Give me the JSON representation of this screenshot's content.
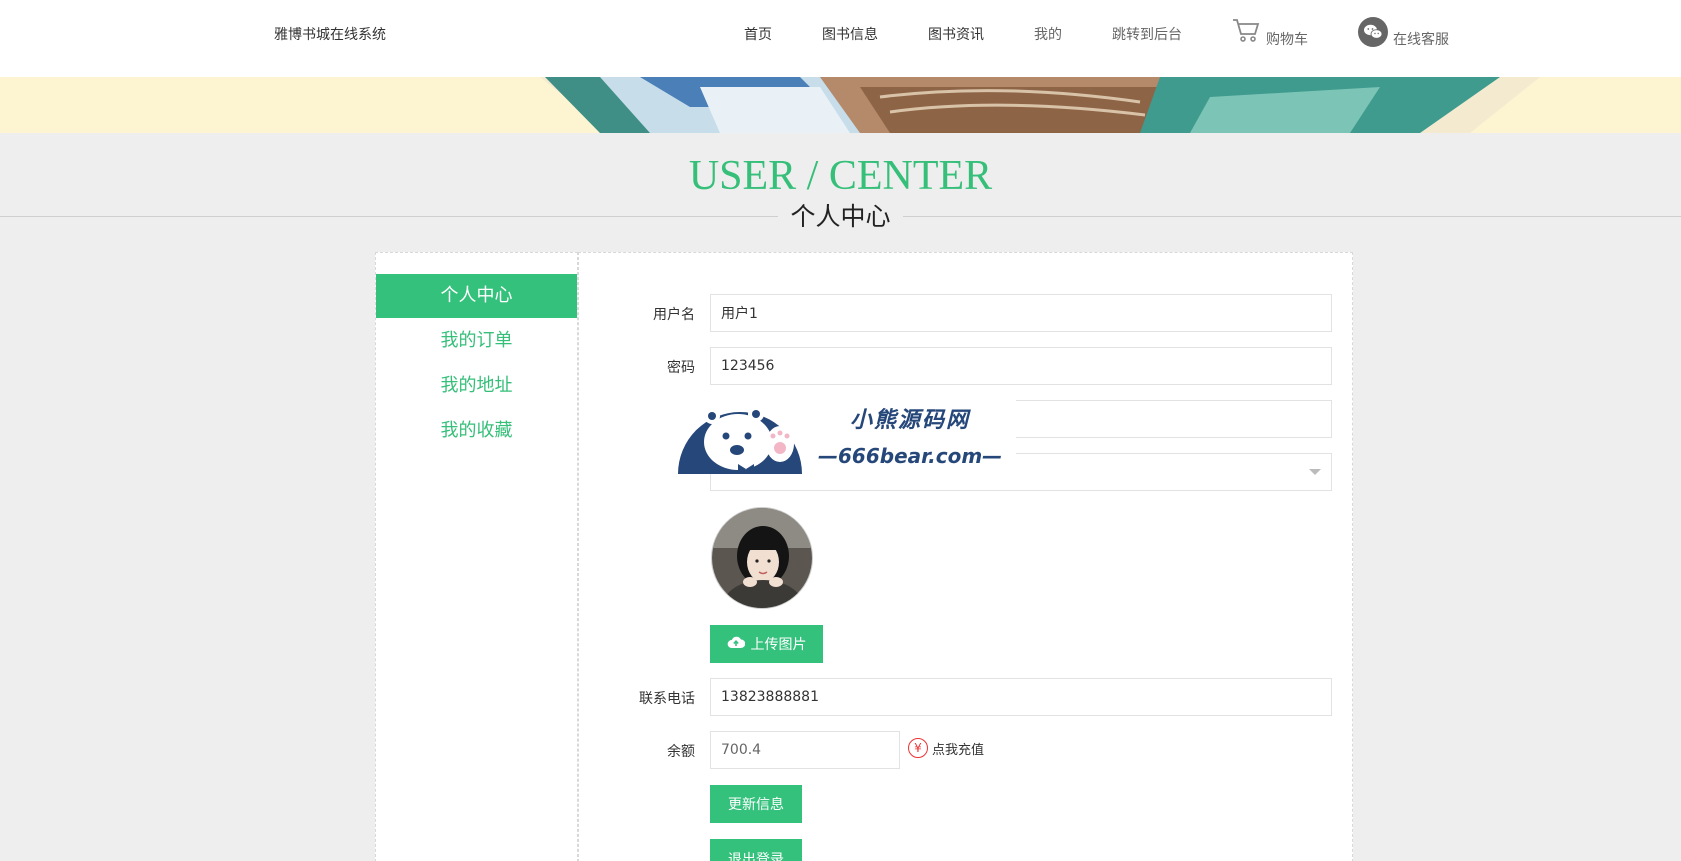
{
  "header": {
    "brand": "雅博书城在线系统",
    "nav": {
      "home": "首页",
      "book_info": "图书信息",
      "book_news": "图书资讯",
      "mine": "我的",
      "admin": "跳转到后台",
      "cart": "购物车",
      "service": "在线客服"
    }
  },
  "page_title": {
    "en": "USER / CENTER",
    "cn": "个人中心"
  },
  "sidebar": {
    "items": [
      {
        "label": "个人中心",
        "active": true
      },
      {
        "label": "我的订单",
        "active": false
      },
      {
        "label": "我的地址",
        "active": false
      },
      {
        "label": "我的收藏",
        "active": false
      }
    ]
  },
  "form": {
    "username": {
      "label": "用户名",
      "value": "用户1"
    },
    "password": {
      "label": "密码",
      "value": "123456"
    },
    "phone": {
      "label": "联系电话",
      "value": "13823888881"
    },
    "balance": {
      "label": "余额",
      "value": "700.4"
    },
    "upload_button": "上传图片",
    "recharge": "点我充值",
    "update_button": "更新信息",
    "logout_button": "退出登录"
  },
  "watermark": {
    "title": "小熊源码网",
    "url": "—666bear.com—"
  },
  "colors": {
    "accent": "#34c17c",
    "watermark": "#26477a",
    "recharge": "#e33333"
  }
}
